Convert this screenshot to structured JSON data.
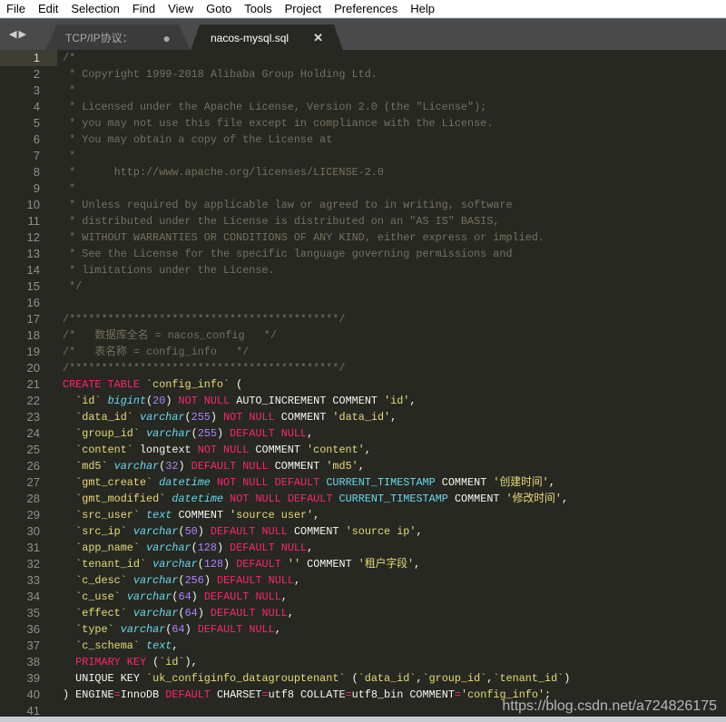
{
  "menu": [
    "File",
    "Edit",
    "Selection",
    "Find",
    "View",
    "Goto",
    "Tools",
    "Project",
    "Preferences",
    "Help"
  ],
  "tabs": [
    {
      "label": "TCP/IP协议：",
      "state": "modified"
    },
    {
      "label": "nacos-mysql.sql",
      "state": "active"
    }
  ],
  "icons": {
    "nav": "arrow-left-right-icon",
    "modified": "dot-icon",
    "close": "close-icon"
  },
  "colors": {
    "background": "#272822",
    "comment": "#75715e",
    "keyword": "#f92672",
    "string": "#e6db74",
    "type": "#66d9ef",
    "number": "#ae81ff"
  },
  "current_line": 1,
  "watermark": "https://blog.csdn.net/a724826175",
  "lines": [
    [
      [
        "c",
        "/*"
      ]
    ],
    [
      [
        "c",
        " * Copyright 1999-2018 Alibaba Group Holding Ltd."
      ]
    ],
    [
      [
        "c",
        " *"
      ]
    ],
    [
      [
        "c",
        " * Licensed under the Apache License, Version 2.0 (the \"License\");"
      ]
    ],
    [
      [
        "c",
        " * you may not use this file except in compliance with the License."
      ]
    ],
    [
      [
        "c",
        " * You may obtain a copy of the License at"
      ]
    ],
    [
      [
        "c",
        " *"
      ]
    ],
    [
      [
        "c",
        " *      http://www.apache.org/licenses/LICENSE-2.0"
      ]
    ],
    [
      [
        "c",
        " *"
      ]
    ],
    [
      [
        "c",
        " * Unless required by applicable law or agreed to in writing, software"
      ]
    ],
    [
      [
        "c",
        " * distributed under the License is distributed on an \"AS IS\" BASIS,"
      ]
    ],
    [
      [
        "c",
        " * WITHOUT WARRANTIES OR CONDITIONS OF ANY KIND, either express or implied."
      ]
    ],
    [
      [
        "c",
        " * See the License for the specific language governing permissions and"
      ]
    ],
    [
      [
        "c",
        " * limitations under the License."
      ]
    ],
    [
      [
        "c",
        " */"
      ]
    ],
    [],
    [
      [
        "c",
        "/******************************************/"
      ]
    ],
    [
      [
        "c",
        "/*   数据库全名 = nacos_config   */"
      ]
    ],
    [
      [
        "c",
        "/*   表名称 = config_info   */"
      ]
    ],
    [
      [
        "c",
        "/******************************************/"
      ]
    ],
    [
      [
        "k",
        "CREATE TABLE "
      ],
      [
        "s",
        "`config_info`"
      ],
      [
        "p",
        " ("
      ]
    ],
    [
      [
        "p",
        "  "
      ],
      [
        "s",
        "`id`"
      ],
      [
        "p",
        " "
      ],
      [
        "t",
        "bigint"
      ],
      [
        "p",
        "("
      ],
      [
        "n",
        "20"
      ],
      [
        "p",
        ") "
      ],
      [
        "k",
        "NOT NULL"
      ],
      [
        "p",
        " AUTO_INCREMENT COMMENT "
      ],
      [
        "s",
        "'id'"
      ],
      [
        "p",
        ","
      ]
    ],
    [
      [
        "p",
        "  "
      ],
      [
        "s",
        "`data_id`"
      ],
      [
        "p",
        " "
      ],
      [
        "t",
        "varchar"
      ],
      [
        "p",
        "("
      ],
      [
        "n",
        "255"
      ],
      [
        "p",
        ") "
      ],
      [
        "k",
        "NOT NULL"
      ],
      [
        "p",
        " COMMENT "
      ],
      [
        "s",
        "'data_id'"
      ],
      [
        "p",
        ","
      ]
    ],
    [
      [
        "p",
        "  "
      ],
      [
        "s",
        "`group_id`"
      ],
      [
        "p",
        " "
      ],
      [
        "t",
        "varchar"
      ],
      [
        "p",
        "("
      ],
      [
        "n",
        "255"
      ],
      [
        "p",
        ") "
      ],
      [
        "k",
        "DEFAULT NULL"
      ],
      [
        "p",
        ","
      ]
    ],
    [
      [
        "p",
        "  "
      ],
      [
        "s",
        "`content`"
      ],
      [
        "p",
        " longtext "
      ],
      [
        "k",
        "NOT NULL"
      ],
      [
        "p",
        " COMMENT "
      ],
      [
        "s",
        "'content'"
      ],
      [
        "p",
        ","
      ]
    ],
    [
      [
        "p",
        "  "
      ],
      [
        "s",
        "`md5`"
      ],
      [
        "p",
        " "
      ],
      [
        "t",
        "varchar"
      ],
      [
        "p",
        "("
      ],
      [
        "n",
        "32"
      ],
      [
        "p",
        ") "
      ],
      [
        "k",
        "DEFAULT NULL"
      ],
      [
        "p",
        " COMMENT "
      ],
      [
        "s",
        "'md5'"
      ],
      [
        "p",
        ","
      ]
    ],
    [
      [
        "p",
        "  "
      ],
      [
        "s",
        "`gmt_create`"
      ],
      [
        "p",
        " "
      ],
      [
        "t",
        "datetime"
      ],
      [
        "p",
        " "
      ],
      [
        "k",
        "NOT NULL DEFAULT"
      ],
      [
        "p",
        " "
      ],
      [
        "f",
        "CURRENT_TIMESTAMP"
      ],
      [
        "p",
        " COMMENT "
      ],
      [
        "s",
        "'创建时间'"
      ],
      [
        "p",
        ","
      ]
    ],
    [
      [
        "p",
        "  "
      ],
      [
        "s",
        "`gmt_modified`"
      ],
      [
        "p",
        " "
      ],
      [
        "t",
        "datetime"
      ],
      [
        "p",
        " "
      ],
      [
        "k",
        "NOT NULL DEFAULT"
      ],
      [
        "p",
        " "
      ],
      [
        "f",
        "CURRENT_TIMESTAMP"
      ],
      [
        "p",
        " COMMENT "
      ],
      [
        "s",
        "'修改时间'"
      ],
      [
        "p",
        ","
      ]
    ],
    [
      [
        "p",
        "  "
      ],
      [
        "s",
        "`src_user`"
      ],
      [
        "p",
        " "
      ],
      [
        "t",
        "text"
      ],
      [
        "p",
        " COMMENT "
      ],
      [
        "s",
        "'source user'"
      ],
      [
        "p",
        ","
      ]
    ],
    [
      [
        "p",
        "  "
      ],
      [
        "s",
        "`src_ip`"
      ],
      [
        "p",
        " "
      ],
      [
        "t",
        "varchar"
      ],
      [
        "p",
        "("
      ],
      [
        "n",
        "50"
      ],
      [
        "p",
        ") "
      ],
      [
        "k",
        "DEFAULT NULL"
      ],
      [
        "p",
        " COMMENT "
      ],
      [
        "s",
        "'source ip'"
      ],
      [
        "p",
        ","
      ]
    ],
    [
      [
        "p",
        "  "
      ],
      [
        "s",
        "`app_name`"
      ],
      [
        "p",
        " "
      ],
      [
        "t",
        "varchar"
      ],
      [
        "p",
        "("
      ],
      [
        "n",
        "128"
      ],
      [
        "p",
        ") "
      ],
      [
        "k",
        "DEFAULT NULL"
      ],
      [
        "p",
        ","
      ]
    ],
    [
      [
        "p",
        "  "
      ],
      [
        "s",
        "`tenant_id`"
      ],
      [
        "p",
        " "
      ],
      [
        "t",
        "varchar"
      ],
      [
        "p",
        "("
      ],
      [
        "n",
        "128"
      ],
      [
        "p",
        ") "
      ],
      [
        "k",
        "DEFAULT"
      ],
      [
        "p",
        " "
      ],
      [
        "s",
        "''"
      ],
      [
        "p",
        " COMMENT "
      ],
      [
        "s",
        "'租户字段'"
      ],
      [
        "p",
        ","
      ]
    ],
    [
      [
        "p",
        "  "
      ],
      [
        "s",
        "`c_desc`"
      ],
      [
        "p",
        " "
      ],
      [
        "t",
        "varchar"
      ],
      [
        "p",
        "("
      ],
      [
        "n",
        "256"
      ],
      [
        "p",
        ") "
      ],
      [
        "k",
        "DEFAULT NULL"
      ],
      [
        "p",
        ","
      ]
    ],
    [
      [
        "p",
        "  "
      ],
      [
        "s",
        "`c_use`"
      ],
      [
        "p",
        " "
      ],
      [
        "t",
        "varchar"
      ],
      [
        "p",
        "("
      ],
      [
        "n",
        "64"
      ],
      [
        "p",
        ") "
      ],
      [
        "k",
        "DEFAULT NULL"
      ],
      [
        "p",
        ","
      ]
    ],
    [
      [
        "p",
        "  "
      ],
      [
        "s",
        "`effect`"
      ],
      [
        "p",
        " "
      ],
      [
        "t",
        "varchar"
      ],
      [
        "p",
        "("
      ],
      [
        "n",
        "64"
      ],
      [
        "p",
        ") "
      ],
      [
        "k",
        "DEFAULT NULL"
      ],
      [
        "p",
        ","
      ]
    ],
    [
      [
        "p",
        "  "
      ],
      [
        "s",
        "`type`"
      ],
      [
        "p",
        " "
      ],
      [
        "t",
        "varchar"
      ],
      [
        "p",
        "("
      ],
      [
        "n",
        "64"
      ],
      [
        "p",
        ") "
      ],
      [
        "k",
        "DEFAULT NULL"
      ],
      [
        "p",
        ","
      ]
    ],
    [
      [
        "p",
        "  "
      ],
      [
        "s",
        "`c_schema`"
      ],
      [
        "p",
        " "
      ],
      [
        "t",
        "text"
      ],
      [
        "p",
        ","
      ]
    ],
    [
      [
        "p",
        "  "
      ],
      [
        "k",
        "PRIMARY KEY"
      ],
      [
        "p",
        " ("
      ],
      [
        "s",
        "`id`"
      ],
      [
        "p",
        "),"
      ]
    ],
    [
      [
        "p",
        "  UNIQUE KEY "
      ],
      [
        "s",
        "`uk_configinfo_datagrouptenant`"
      ],
      [
        "p",
        " ("
      ],
      [
        "s",
        "`data_id`"
      ],
      [
        "p",
        ","
      ],
      [
        "s",
        "`group_id`"
      ],
      [
        "p",
        ","
      ],
      [
        "s",
        "`tenant_id`"
      ],
      [
        "p",
        ")"
      ]
    ],
    [
      [
        "p",
        ") ENGINE"
      ],
      [
        "k",
        "="
      ],
      [
        "p",
        "InnoDB "
      ],
      [
        "k",
        "DEFAULT"
      ],
      [
        "p",
        " CHARSET"
      ],
      [
        "k",
        "="
      ],
      [
        "p",
        "utf8 COLLATE"
      ],
      [
        "k",
        "="
      ],
      [
        "p",
        "utf8_bin COMMENT"
      ],
      [
        "k",
        "="
      ],
      [
        "s",
        "'config_info'"
      ],
      [
        "p",
        ";"
      ]
    ],
    []
  ]
}
